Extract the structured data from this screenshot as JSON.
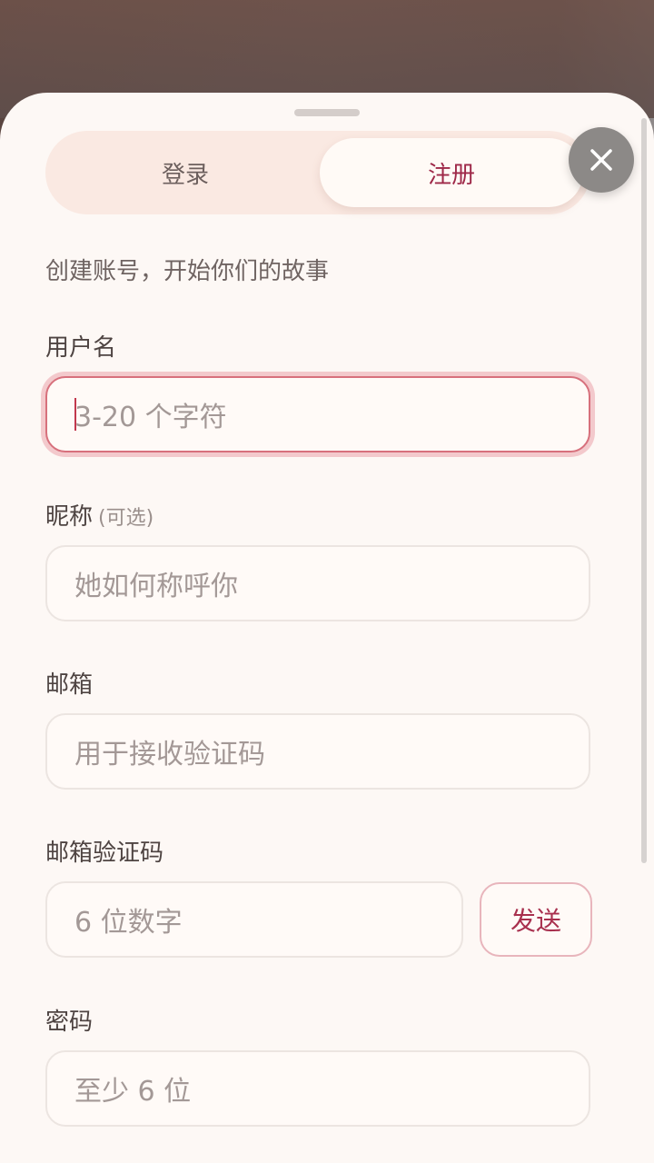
{
  "tabs": {
    "login": "登录",
    "register": "注册"
  },
  "subtitle": "创建账号，开始你们的故事",
  "form": {
    "username": {
      "label": "用户名",
      "placeholder": "3-20 个字符"
    },
    "nickname": {
      "label": "昵称",
      "optional": "(可选)",
      "placeholder": "她如何称呼你"
    },
    "email": {
      "label": "邮箱",
      "placeholder": "用于接收验证码"
    },
    "email_code": {
      "label": "邮箱验证码",
      "placeholder": "6 位数字",
      "send_label": "发送"
    },
    "password": {
      "label": "密码",
      "placeholder": "至少 6 位"
    }
  },
  "icons": {
    "close": "close-icon"
  },
  "colors": {
    "accent": "#9e2848",
    "sheet_background": "#fdf8f5",
    "focus_border": "#d7707c"
  }
}
